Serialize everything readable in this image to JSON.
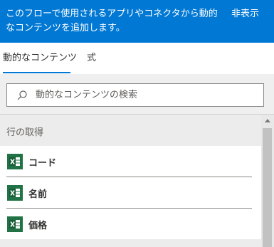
{
  "banner": {
    "text": "このフローで使用されるアプリやコネクタから動的なコンテンツを追加します。",
    "hide_label": "非表示",
    "background": "#0078d4"
  },
  "tabs": [
    {
      "label": "動的なコンテンツ",
      "selected": true
    },
    {
      "label": "式",
      "selected": false
    }
  ],
  "search": {
    "value": "",
    "placeholder": "動的なコンテンツの検索",
    "icon": "search-icon"
  },
  "section": {
    "title": "行の取得",
    "items": [
      {
        "label": "コード",
        "icon": "excel-icon"
      },
      {
        "label": "名前",
        "icon": "excel-icon"
      },
      {
        "label": "価格",
        "icon": "excel-icon"
      }
    ]
  },
  "colors": {
    "accent": "#0078d4",
    "excel": "#217346"
  }
}
